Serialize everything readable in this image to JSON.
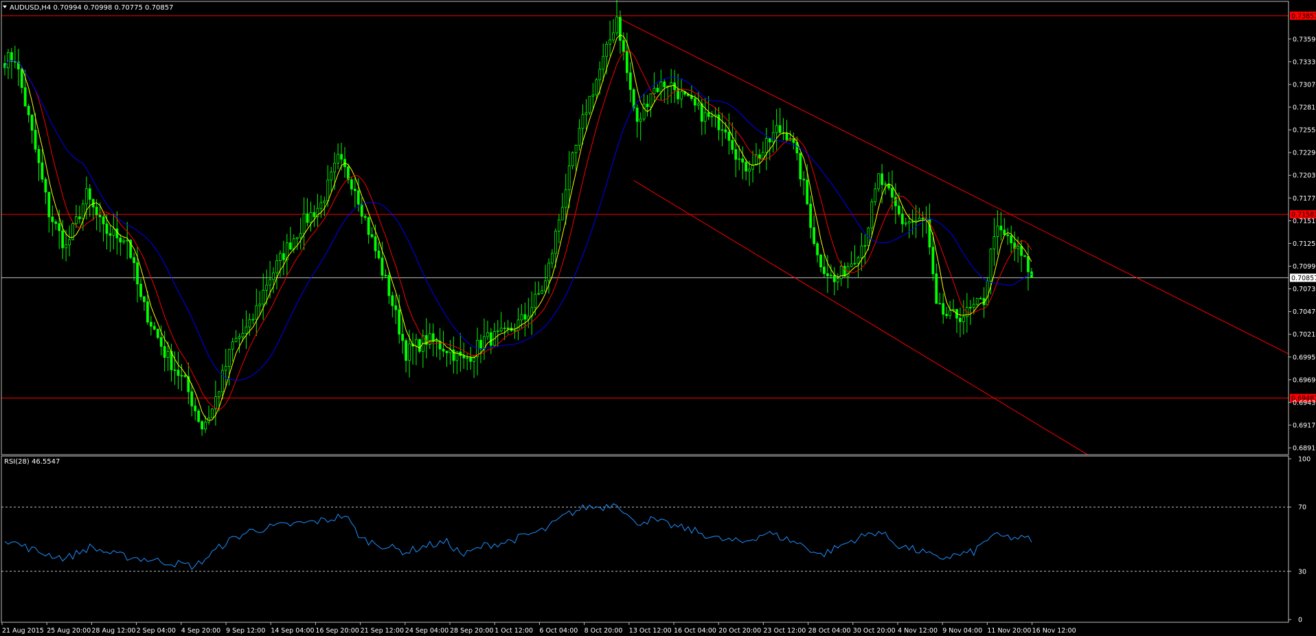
{
  "header": {
    "symbol_line": "AUDUSD,H4  0.70994 0.70998 0.70775 0.70857"
  },
  "rsi_panel": {
    "label": "RSI(28) 46.5547"
  },
  "colors": {
    "background": "#000000",
    "candle": "#00ff00",
    "ma_fast": "#ffff00",
    "ma_mid": "#ff0000",
    "ma_slow": "#0000ff",
    "rsi_line": "#1e90ff",
    "level_line": "#ff0000",
    "current_price_line": "#c0c0c0",
    "price_tag_red": "#ff0000"
  },
  "chart_data": [
    {
      "type": "line",
      "title": "AUDUSD,H4",
      "ylim": [
        0.68832,
        0.74005
      ],
      "y_ticks": [
        "0.73590",
        "0.73330",
        "0.73070",
        "0.72810",
        "0.72550",
        "0.72290",
        "0.72030",
        "0.71770",
        "0.71510",
        "0.71250",
        "0.70990",
        "0.70730",
        "0.70470",
        "0.70210",
        "0.69950",
        "0.69690",
        "0.69430",
        "0.69170",
        "0.68910"
      ],
      "x_labels": [
        "21 Aug 2015",
        "25 Aug 20:00",
        "28 Aug 12:00",
        "2 Sep 04:00",
        "4 Sep 20:00",
        "9 Sep 12:00",
        "14 Sep 04:00",
        "16 Sep 20:00",
        "21 Sep 12:00",
        "24 Sep 04:00",
        "28 Sep 20:00",
        "1 Oct 12:00",
        "6 Oct 04:00",
        "8 Oct 20:00",
        "13 Oct 12:00",
        "16 Oct 04:00",
        "20 Oct 20:00",
        "23 Oct 12:00",
        "28 Oct 04:00",
        "30 Oct 20:00",
        "4 Nov 12:00",
        "9 Nov 04:00",
        "11 Nov 20:00",
        "16 Nov 12:00"
      ],
      "anchors": [
        [
          0,
          0.7335
        ],
        [
          3,
          0.7338
        ],
        [
          8,
          0.725
        ],
        [
          13,
          0.716
        ],
        [
          18,
          0.712
        ],
        [
          24,
          0.718
        ],
        [
          29,
          0.714
        ],
        [
          36,
          0.713
        ],
        [
          40,
          0.706
        ],
        [
          47,
          0.7
        ],
        [
          53,
          0.6965
        ],
        [
          58,
          0.6915
        ],
        [
          61,
          0.6935
        ],
        [
          67,
          0.701
        ],
        [
          72,
          0.703
        ],
        [
          77,
          0.708
        ],
        [
          83,
          0.712
        ],
        [
          88,
          0.715
        ],
        [
          93,
          0.717
        ],
        [
          98,
          0.722
        ],
        [
          103,
          0.719
        ],
        [
          107,
          0.714
        ],
        [
          113,
          0.707
        ],
        [
          118,
          0.7
        ],
        [
          124,
          0.7015
        ],
        [
          130,
          0.7005
        ],
        [
          135,
          0.699
        ],
        [
          141,
          0.7015
        ],
        [
          147,
          0.702
        ],
        [
          153,
          0.704
        ],
        [
          159,
          0.708
        ],
        [
          165,
          0.719
        ],
        [
          171,
          0.728
        ],
        [
          177,
          0.7345
        ],
        [
          180,
          0.7385
        ],
        [
          183,
          0.732
        ],
        [
          186,
          0.726
        ],
        [
          190,
          0.73
        ],
        [
          195,
          0.731
        ],
        [
          200,
          0.729
        ],
        [
          206,
          0.727
        ],
        [
          212,
          0.726
        ],
        [
          217,
          0.721
        ],
        [
          223,
          0.723
        ],
        [
          227,
          0.7255
        ],
        [
          231,
          0.725
        ],
        [
          235,
          0.719
        ],
        [
          239,
          0.711
        ],
        [
          244,
          0.708
        ],
        [
          249,
          0.7105
        ],
        [
          253,
          0.713
        ],
        [
          257,
          0.72
        ],
        [
          260,
          0.718
        ],
        [
          264,
          0.715
        ],
        [
          268,
          0.715
        ],
        [
          271,
          0.715
        ],
        [
          274,
          0.705
        ],
        [
          278,
          0.704
        ],
        [
          283,
          0.7045
        ],
        [
          288,
          0.706
        ],
        [
          291,
          0.714
        ],
        [
          295,
          0.713
        ],
        [
          299,
          0.711
        ],
        [
          302,
          0.709
        ]
      ],
      "current_price": 0.70857,
      "horizontal_levels": [
        {
          "price": 0.73857,
          "tag": "0.73857"
        },
        {
          "price": 0.71583,
          "tag": "0.71583"
        },
        {
          "price": 0.69481,
          "tag": "0.69481"
        }
      ],
      "current_price_tag": "0.70857",
      "moving_averages": [
        "fast",
        "mid",
        "slow"
      ],
      "channel_lines": [
        {
          "x1_index": 180,
          "y1": 0.7384,
          "x2_index": 382,
          "y2": 0.699
        },
        {
          "x1_index": 185,
          "y1": 0.7197,
          "x2_index": 319,
          "y2": 0.6882
        }
      ]
    },
    {
      "type": "line",
      "title": "RSI(28)",
      "ylim": [
        0,
        100
      ],
      "y_ticks": [
        "100",
        "70",
        "30",
        "0"
      ],
      "levels": [
        70,
        30
      ],
      "anchors": [
        [
          0,
          50
        ],
        [
          10,
          42
        ],
        [
          18,
          38
        ],
        [
          25,
          45
        ],
        [
          33,
          40
        ],
        [
          40,
          38
        ],
        [
          50,
          35
        ],
        [
          56,
          33
        ],
        [
          65,
          48
        ],
        [
          72,
          55
        ],
        [
          80,
          58
        ],
        [
          88,
          60
        ],
        [
          95,
          62
        ],
        [
          100,
          65
        ],
        [
          105,
          50
        ],
        [
          113,
          45
        ],
        [
          118,
          42
        ],
        [
          124,
          46
        ],
        [
          130,
          48
        ],
        [
          135,
          40
        ],
        [
          141,
          46
        ],
        [
          147,
          48
        ],
        [
          153,
          52
        ],
        [
          159,
          56
        ],
        [
          165,
          65
        ],
        [
          171,
          70
        ],
        [
          176,
          70
        ],
        [
          180,
          73
        ],
        [
          185,
          60
        ],
        [
          190,
          62
        ],
        [
          197,
          58
        ],
        [
          203,
          55
        ],
        [
          210,
          50
        ],
        [
          217,
          48
        ],
        [
          224,
          54
        ],
        [
          230,
          50
        ],
        [
          235,
          46
        ],
        [
          240,
          40
        ],
        [
          245,
          45
        ],
        [
          250,
          50
        ],
        [
          257,
          55
        ],
        [
          263,
          46
        ],
        [
          270,
          42
        ],
        [
          274,
          38
        ],
        [
          280,
          40
        ],
        [
          285,
          42
        ],
        [
          290,
          52
        ],
        [
          296,
          51
        ],
        [
          301,
          50
        ],
        [
          303,
          49
        ]
      ]
    }
  ]
}
